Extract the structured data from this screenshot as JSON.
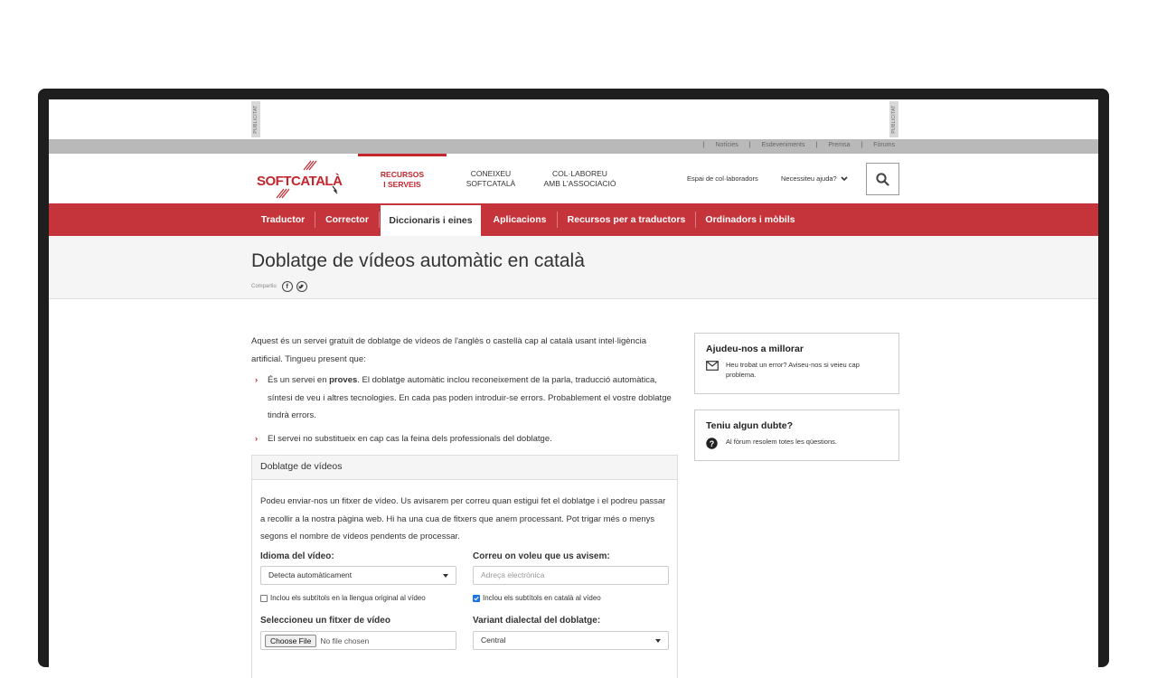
{
  "ads": {
    "label": "PUBLICITAT"
  },
  "top_links": [
    "Notícies",
    "Esdeveniments",
    "Premsa",
    "Fòrums"
  ],
  "logo": {
    "text": "SOFTCATALÀ"
  },
  "main_nav": [
    {
      "line1": "RECURSOS",
      "line2": "I SERVEIS",
      "active": true
    },
    {
      "line1": "CONEIXEU",
      "line2": "SOFTCATALÀ",
      "active": false
    },
    {
      "line1": "COL·LABOREU",
      "line2": "AMB L'ASSOCIACIÓ",
      "active": false
    }
  ],
  "header_links": {
    "collab": "Espai de col·laboradors",
    "help": "Necessiteu ajuda?"
  },
  "red_nav": [
    {
      "label": "Traductor"
    },
    {
      "label": "Corrector"
    },
    {
      "label": "Diccionaris i eines",
      "active": true
    },
    {
      "label": "Aplicacions"
    },
    {
      "label": "Recursos per a traductors"
    },
    {
      "label": "Ordinadors i mòbils"
    }
  ],
  "page": {
    "title": "Doblatge de vídeos automàtic en català",
    "share_label": "Compartiu",
    "intro": "Aquest és un servei gratuït de doblatge de vídeos de l'anglès o castellà cap al català usant intel·ligència artificial. Tingueu present que:",
    "bullet1_pre": "És un servei en ",
    "bullet1_bold": "proves",
    "bullet1_post": ". El doblatge automàtic inclou reconeixement de la parla, traducció automàtica, síntesi de veu i altres tecnologies. En cada pas poden introduir-se errors. Probablement el vostre doblatge tindrà errors.",
    "bullet2": "El servei no substitueix en cap cas la feina dels professionals del doblatge."
  },
  "panel": {
    "heading": "Doblatge de vídeos",
    "description": "Podeu enviar-nos un fitxer de vídeo. Us avisarem per correu quan estigui fet el doblatge i el podreu passar a recollir a la nostra pàgina web. Hi ha una cua de fitxers que anem processant. Pot trigar més o menys segons el nombre de vídeos pendents de processar.",
    "lang_label": "Idioma del vídeo:",
    "lang_value": "Detecta automàticament",
    "email_label": "Correu on voleu que us avisem:",
    "email_placeholder": "Adreça electrònica",
    "chk_original": "Inclou els subtítols en la llengua original al vídeo",
    "chk_original_checked": false,
    "chk_catalan": "Inclou els subtítols en català al vídeo",
    "chk_catalan_checked": true,
    "file_label": "Seleccioneu un fitxer de vídeo",
    "file_button": "Choose File",
    "file_status": "No file chosen",
    "variant_label": "Variant dialectal del doblatge:",
    "variant_value": "Central"
  },
  "sidebar": {
    "box1_title": "Ajudeu-nos a millorar",
    "box1_text": "Heu trobat un error? Aviseu-nos si veieu cap problema.",
    "box2_title": "Teniu algun dubte?",
    "box2_text": "Al fòrum resolem totes les qüestions."
  }
}
